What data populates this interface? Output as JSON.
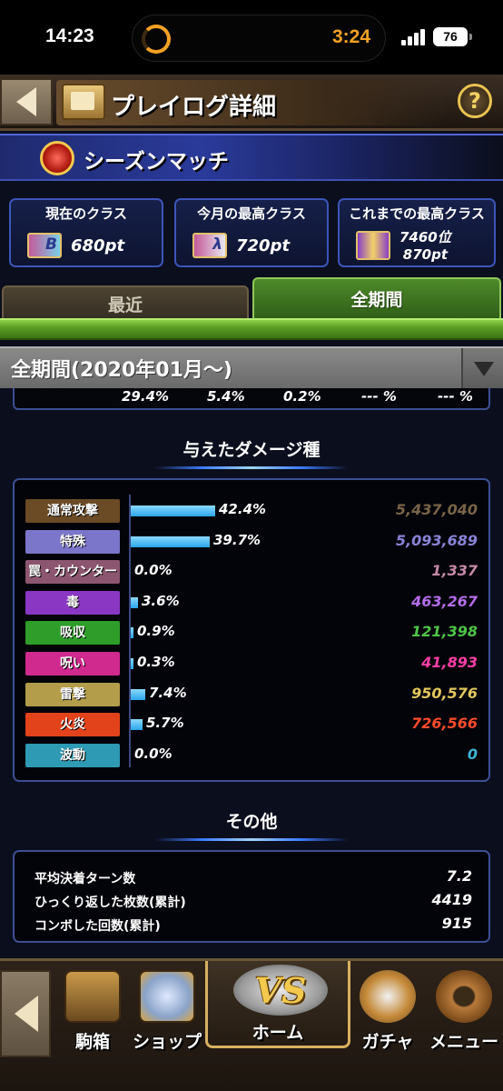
{
  "status_bar": {
    "time": "14:23",
    "timer": "3:24",
    "battery": "76"
  },
  "header": {
    "title": "プレイログ詳細",
    "help": "?"
  },
  "season": {
    "label": "シーズンマッチ"
  },
  "cards": [
    {
      "heading": "現在のクラス",
      "badge": "B",
      "value": "680pt"
    },
    {
      "heading": "今月の最高クラス",
      "badge": "λ",
      "value": "720pt"
    },
    {
      "heading": "これまでの最高クラス",
      "rank": "7460位",
      "value": "870pt"
    }
  ],
  "tabs": {
    "recent": "最近",
    "all": "全期間"
  },
  "period": {
    "selected": "全期間(2020年01月～)"
  },
  "prev_row": [
    "29.4%",
    "5.4%",
    "0.2%",
    "--- %",
    "--- %"
  ],
  "damage": {
    "title": "与えたダメージ種",
    "rows": [
      {
        "label": "通常攻撃",
        "pct": "42.4%",
        "ratio": 0.424,
        "value": "5,437,040",
        "label_color": "#6b4a26",
        "value_color": "#7a6448"
      },
      {
        "label": "特殊",
        "pct": "39.7%",
        "ratio": 0.397,
        "value": "5,093,689",
        "label_color": "#7b76c9",
        "value_color": "#8a84d8"
      },
      {
        "label": "罠・カウンター",
        "pct": "0.0%",
        "ratio": 0.0,
        "value": "1,337",
        "label_color": "#8c5570",
        "value_color": "#c689a8"
      },
      {
        "label": "毒",
        "pct": "3.6%",
        "ratio": 0.036,
        "value": "463,267",
        "label_color": "#8a37c4",
        "value_color": "#b46ce8"
      },
      {
        "label": "吸収",
        "pct": "0.9%",
        "ratio": 0.009,
        "value": "121,398",
        "label_color": "#2f9d2a",
        "value_color": "#4ec546"
      },
      {
        "label": "呪い",
        "pct": "0.3%",
        "ratio": 0.003,
        "value": "41,893",
        "label_color": "#d02a8e",
        "value_color": "#ff3fa8"
      },
      {
        "label": "雷撃",
        "pct": "7.4%",
        "ratio": 0.074,
        "value": "950,576",
        "label_color": "#b39c4a",
        "value_color": "#e2c65e"
      },
      {
        "label": "火炎",
        "pct": "5.7%",
        "ratio": 0.057,
        "value": "726,566",
        "label_color": "#e2431b",
        "value_color": "#ff4b2b"
      },
      {
        "label": "波動",
        "pct": "0.0%",
        "ratio": 0.0,
        "value": "0",
        "label_color": "#2e9ab3",
        "value_color": "#3fb6d6"
      }
    ]
  },
  "other": {
    "title": "その他",
    "rows": [
      {
        "label": "平均決着ターン数",
        "value": "7.2"
      },
      {
        "label": "ひっくり返した枚数(累計)",
        "value": "4419"
      },
      {
        "label": "コンボした回数(累計)",
        "value": "915"
      }
    ]
  },
  "nav": {
    "piece_box": "駒箱",
    "shop": "ショップ",
    "home": "ホーム",
    "vs": "VS",
    "gacha": "ガチャ",
    "menu": "メニュー"
  }
}
